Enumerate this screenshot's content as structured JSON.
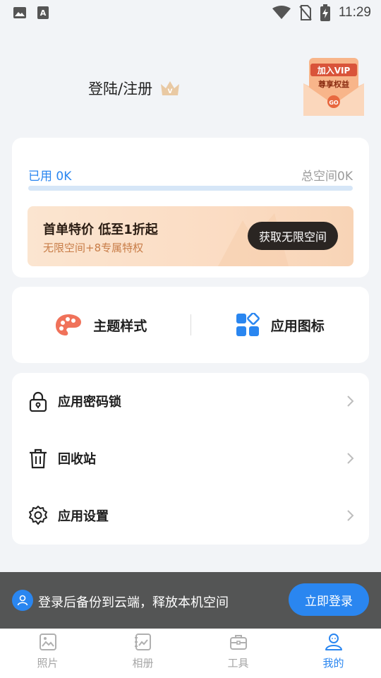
{
  "status_bar": {
    "time": "11:29"
  },
  "header": {
    "login_label": "登陆/注册",
    "vip_line1": "加入VIP",
    "vip_line2": "尊享权益",
    "vip_go": "GO"
  },
  "storage": {
    "used_label": "已用 0K",
    "total_label": "总空间0K",
    "used_fraction": 0.0,
    "promo_title": "首单特价  低至1折起",
    "promo_subtitle": "无限空间+8专属特权",
    "promo_button": "获取无限空间"
  },
  "quick_actions": [
    {
      "label": "主题样式",
      "icon": "palette-icon"
    },
    {
      "label": "应用图标",
      "icon": "app-grid-icon"
    }
  ],
  "settings": [
    {
      "label": "应用密码锁",
      "icon": "lock-icon"
    },
    {
      "label": "回收站",
      "icon": "trash-icon"
    },
    {
      "label": "应用设置",
      "icon": "gear-icon"
    }
  ],
  "banner": {
    "text": "登录后备份到云端，释放本机空间",
    "button": "立即登录"
  },
  "nav": [
    {
      "label": "照片",
      "icon": "photo-icon",
      "active": false
    },
    {
      "label": "相册",
      "icon": "album-icon",
      "active": false
    },
    {
      "label": "工具",
      "icon": "toolbox-icon",
      "active": false
    },
    {
      "label": "我的",
      "icon": "profile-icon",
      "active": true
    }
  ],
  "colors": {
    "accent": "#2a86f0",
    "background": "#f2f4f7",
    "promo_button": "#2a2522"
  }
}
